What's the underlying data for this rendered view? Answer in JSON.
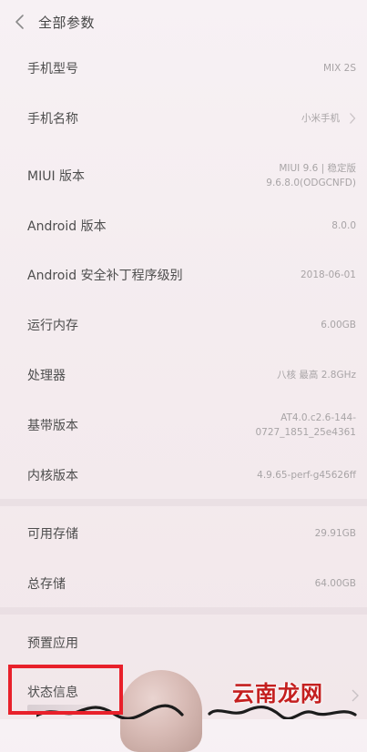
{
  "header": {
    "title": "全部参数"
  },
  "rows": [
    {
      "label": "手机型号",
      "value_lines": [
        "MIX 2S"
      ]
    },
    {
      "label": "手机名称",
      "value_lines": [
        "小米手机"
      ]
    },
    {
      "label": "MIUI 版本",
      "value_lines": [
        "MIUI 9.6 | 稳定版",
        "9.6.8.0(ODGCNFD)"
      ]
    },
    {
      "label": "Android 版本",
      "value_lines": [
        "8.0.0"
      ]
    },
    {
      "label": "Android 安全补丁程序级别",
      "value_lines": [
        "2018-06-01"
      ]
    },
    {
      "label": "运行内存",
      "value_lines": [
        "6.00GB"
      ]
    },
    {
      "label": "处理器",
      "value_lines": [
        "八核 最高 2.8GHz"
      ]
    },
    {
      "label": "基带版本",
      "value_lines": [
        "AT4.0.c2.6-144-",
        "0727_1851_25e4361"
      ]
    },
    {
      "label": "内核版本",
      "value_lines": [
        "4.9.65-perf-g45626ff"
      ]
    },
    {
      "label": "可用存储",
      "value_lines": [
        "29.91GB"
      ]
    },
    {
      "label": "总存储",
      "value_lines": [
        "64.00GB"
      ]
    },
    {
      "label": "预置应用",
      "value_lines": []
    }
  ],
  "status": {
    "label": "状态信息"
  },
  "watermark": {
    "text": "云南龙网"
  },
  "colors": {
    "highlight": "#e8202a",
    "watermark": "#c41f1f"
  },
  "icons": {
    "back": "chevron-left-icon",
    "row_arrow": "chevron-right-icon"
  }
}
